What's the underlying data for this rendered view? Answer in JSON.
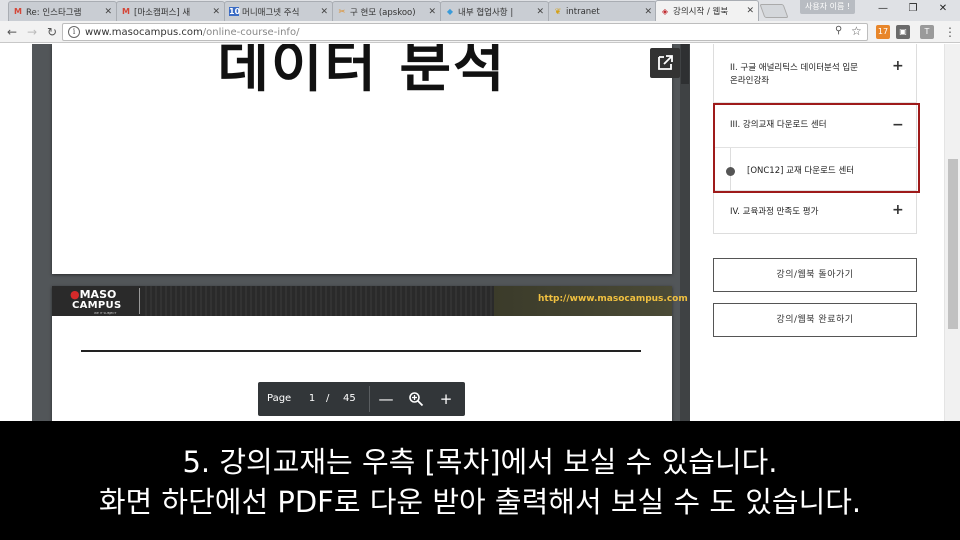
{
  "browser": {
    "tabs": [
      {
        "favicon": "gmail-icon",
        "title": "Re: 인스타그램 ",
        "active": false
      },
      {
        "favicon": "gmail-icon",
        "title": "[마소캠퍼스] 새",
        "active": false
      },
      {
        "favicon": "calendar-icon",
        "title": "머니매그넷 주식",
        "active": false
      },
      {
        "favicon": "tools-icon",
        "title": "구 현모 (apskoo)",
        "active": false
      },
      {
        "favicon": "chat-icon",
        "title": "내부 협업사항 |",
        "active": false
      },
      {
        "favicon": "intranet-icon",
        "title": "intranet",
        "active": false
      },
      {
        "favicon": "maso-icon",
        "title": "강의시작 / 웹북 ",
        "active": true
      }
    ],
    "user_badge": "사용자 이름 !",
    "url_host": "www.masocampus.com",
    "url_path": "/online-course-info/",
    "colors": {
      "brand": "#9e1a1a",
      "caption_bg": "#000000"
    }
  },
  "pdf": {
    "heading": "데이터 분석",
    "logo_maso": "MASO",
    "logo_campus": "CAMPUS",
    "logo_tagline": "WE IT SUBJECT",
    "banner_url": "http://www.masocampus.com",
    "pager": {
      "label": "Page",
      "current": "1",
      "slash": "/",
      "total": "45"
    }
  },
  "sidebar": {
    "toc": [
      {
        "label_1": "II. 구글 애널리틱스 데이터분석 입문",
        "label_2": "온라인강좌",
        "toggle": "+"
      },
      {
        "label_1": "III. 강의교재 다운로드 센터",
        "toggle": "−"
      },
      {
        "label_1": "[ONC12] 교재 다운로드 센터"
      },
      {
        "label_1": "IV. 교육과정 만족도 평가",
        "toggle": "+"
      }
    ],
    "buttons": {
      "back": "강의/웹북 돌아가기",
      "complete": "강의/웹북 완료하기"
    }
  },
  "caption": {
    "line1": "5. 강의교재는 우측 [목차]에서 보실 수 있습니다.",
    "line2": "화면 하단에선 PDF로 다운 받아 출력해서 보실 수 도 있습니다."
  }
}
